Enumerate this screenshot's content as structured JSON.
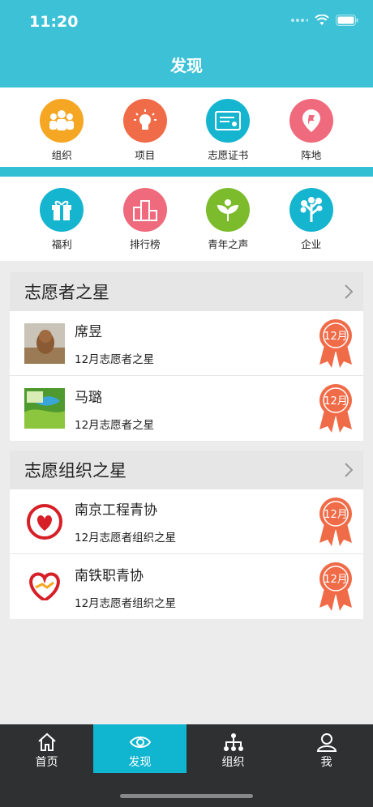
{
  "status": {
    "time": "11:20"
  },
  "nav": {
    "title": "发现"
  },
  "grid": [
    {
      "label": "组织",
      "color": "#f5a623",
      "icon": "people-icon"
    },
    {
      "label": "项目",
      "color": "#f06b47",
      "icon": "lightbulb-icon"
    },
    {
      "label": "志愿证书",
      "color": "#15b4cf",
      "icon": "certificate-icon"
    },
    {
      "label": "阵地",
      "color": "#ee6a7c",
      "icon": "pin-icon"
    },
    {
      "label": "福利",
      "color": "#15b4cf",
      "icon": "gift-icon"
    },
    {
      "label": "排行榜",
      "color": "#ee6a7c",
      "icon": "podium-icon"
    },
    {
      "label": "青年之声",
      "color": "#7cbc2c",
      "icon": "sprout-icon"
    },
    {
      "label": "企业",
      "color": "#15b4cf",
      "icon": "tree-icon"
    }
  ],
  "sections": [
    {
      "title": "志愿者之星",
      "items": [
        {
          "name": "席昱",
          "desc": "12月志愿者之星",
          "medal": "12月"
        },
        {
          "name": "马璐",
          "desc": "12月志愿者之星",
          "medal": "12月"
        }
      ]
    },
    {
      "title": "志愿组织之星",
      "items": [
        {
          "name": "南京工程青协",
          "desc": "12月志愿者组织之星",
          "medal": "12月"
        },
        {
          "name": "南铁职青协",
          "desc": "12月志愿者组织之星",
          "medal": "12月"
        }
      ]
    }
  ],
  "tabs": [
    {
      "label": "首页"
    },
    {
      "label": "发现"
    },
    {
      "label": "组织"
    },
    {
      "label": "我"
    }
  ],
  "colors": {
    "header": "#3cc1d6",
    "medal": "#f06b47",
    "tab_active": "#10b5d0"
  }
}
